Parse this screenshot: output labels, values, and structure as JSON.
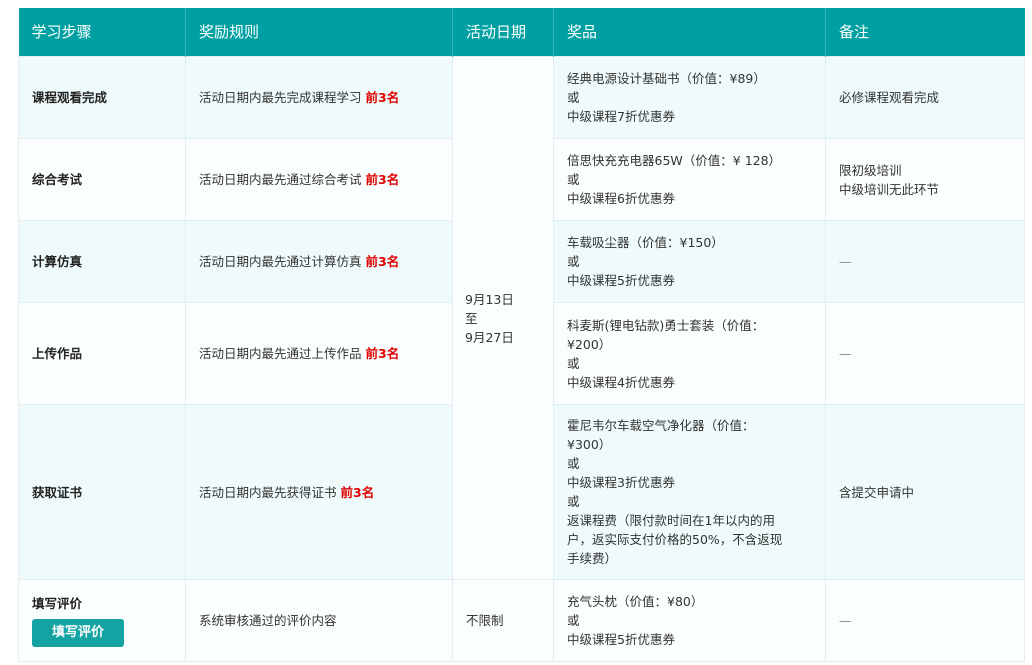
{
  "headers": [
    "学习步骤",
    "奖励规则",
    "活动日期",
    "奖品",
    "备注"
  ],
  "activity_date": "9月13日\n至\n9月27日",
  "rows": [
    {
      "step": "课程观看完成",
      "rule": "活动日期内最先完成课程学习",
      "rule_highlight": "前3名",
      "prize": "经典电源设计基础书（价值：¥89）\n或\n中级课程7折优惠券",
      "note": "必修课程观看完成"
    },
    {
      "step": "综合考试",
      "rule": "活动日期内最先通过综合考试",
      "rule_highlight": "前3名",
      "prize": "倍思快充充电器65W（价值：¥ 128）\n或\n中级课程6折优惠券",
      "note": "限初级培训\n中级培训无此环节"
    },
    {
      "step": "计算仿真",
      "rule": "活动日期内最先通过计算仿真",
      "rule_highlight": "前3名",
      "prize": "车载吸尘器（价值：¥150）\n或\n中级课程5折优惠券",
      "note": "—"
    },
    {
      "step": "上传作品",
      "rule": "活动日期内最先通过上传作品",
      "rule_highlight": "前3名",
      "prize": "科麦斯(锂电钻款)勇士套装（价值：\n¥200）\n或\n中级课程4折优惠券",
      "note": "—"
    },
    {
      "step": "获取证书",
      "rule": "活动日期内最先获得证书",
      "rule_highlight": "前3名",
      "prize": "霍尼韦尔车载空气净化器（价值：\n¥300）\n或\n中级课程3折优惠券\n或\n返课程费（限付款时间在1年以内的用\n户，返实际支付价格的50%，不含返现\n手续费）",
      "note": "含提交申请中"
    },
    {
      "step": "填写评价",
      "button": "填写评价",
      "rule": "系统审核通过的评价内容",
      "date": "不限制",
      "prize": "充气头枕（价值：¥80）\n或\n中级课程5折优惠券",
      "note": "—"
    }
  ]
}
